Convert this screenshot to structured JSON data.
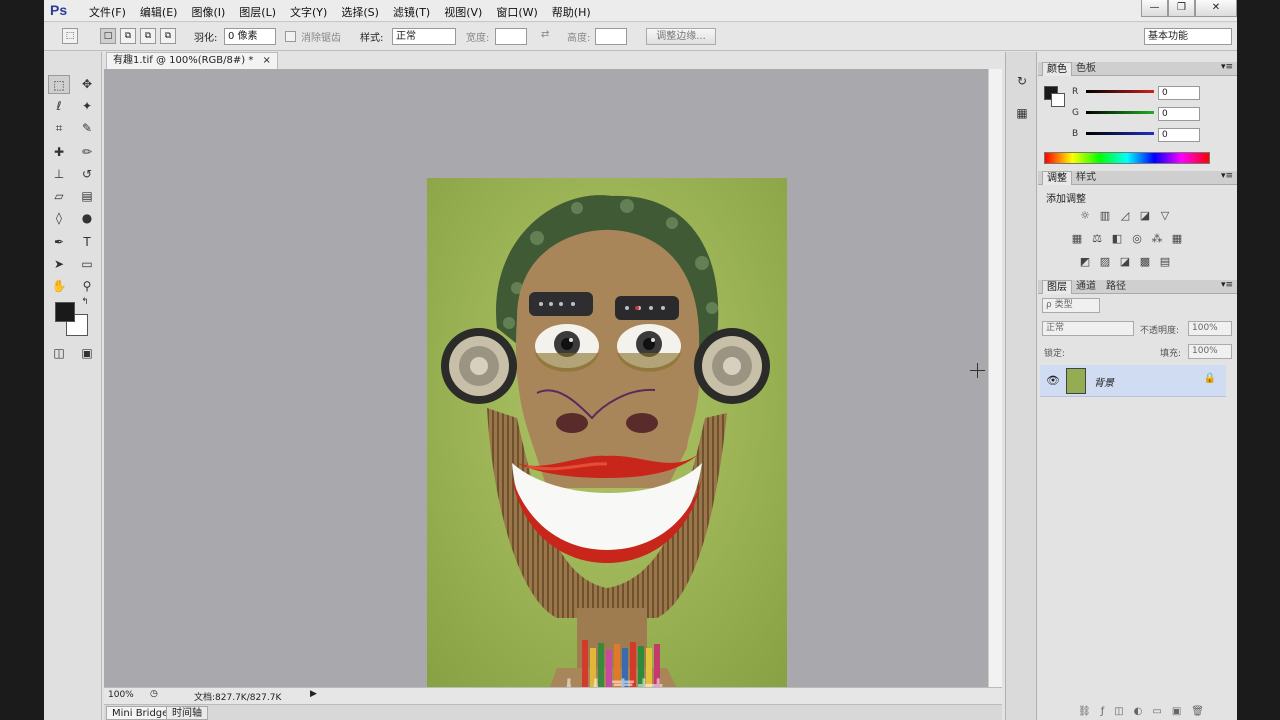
{
  "app": {
    "logo": "Ps",
    "menu": [
      "文件(F)",
      "编辑(E)",
      "图像(I)",
      "图层(L)",
      "文字(Y)",
      "选择(S)",
      "滤镜(T)",
      "视图(V)",
      "窗口(W)",
      "帮助(H)"
    ],
    "window_buttons": [
      "—",
      "❐",
      "✕"
    ]
  },
  "options": {
    "feather_label": "羽化:",
    "feather_value": "0 像素",
    "antialias": "消除锯齿",
    "style_label": "样式:",
    "style_value": "正常",
    "width_label": "宽度:",
    "height_label": "高度:",
    "refine_edge": "调整边缘...",
    "workspace": "基本功能"
  },
  "document": {
    "tab_title": "有趣1.tif @ 100%(RGB/8#) *",
    "zoom": "100%",
    "doc_info": "文档:827.7K/827.7K"
  },
  "bottom_tabs": [
    "Mini Bridge",
    "时间轴"
  ],
  "color_panel": {
    "tabs": [
      "颜色",
      "色板"
    ],
    "channels": [
      {
        "label": "R",
        "value": "0",
        "color": "#d02020"
      },
      {
        "label": "G",
        "value": "0",
        "color": "#20b020"
      },
      {
        "label": "B",
        "value": "0",
        "color": "#2030c0"
      }
    ]
  },
  "adjust_panel": {
    "tabs": [
      "调整",
      "样式"
    ],
    "title": "添加调整"
  },
  "layers_panel": {
    "tabs": [
      "图层",
      "通道",
      "路径"
    ],
    "filter": "ρ 类型",
    "blend_mode": "正常",
    "opacity_label": "不透明度:",
    "opacity_value": "100%",
    "lock_label": "锁定:",
    "fill_label": "填充:",
    "fill_value": "100%",
    "layers": [
      {
        "name": "背景",
        "visible": true,
        "locked": true
      }
    ]
  },
  "watermark": "人人素材"
}
